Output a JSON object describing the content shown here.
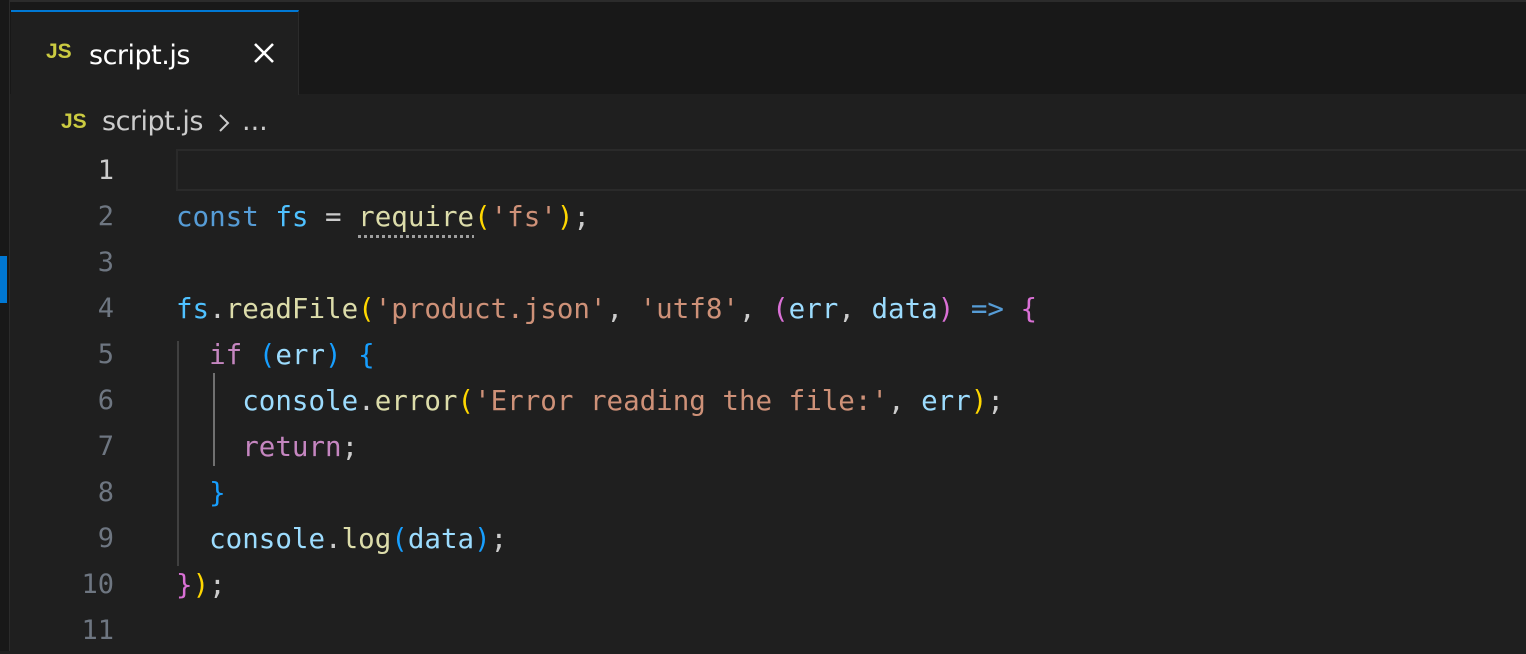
{
  "tab": {
    "icon_label": "JS",
    "title": "script.js",
    "close_icon": "close-icon"
  },
  "breadcrumb": {
    "icon_label": "JS",
    "file": "script.js",
    "separator_icon": "chevron-right-icon",
    "more": "..."
  },
  "editor": {
    "language": "javascript",
    "current_line": 1,
    "line_numbers": [
      "1",
      "2",
      "3",
      "4",
      "5",
      "6",
      "7",
      "8",
      "9",
      "10",
      "11"
    ],
    "lines": [
      "",
      "const fs = require('fs');",
      "",
      "fs.readFile('product.json', 'utf8', (err, data) => {",
      "  if (err) {",
      "    console.error('Error reading the file:', err);",
      "    return;",
      "  }",
      "  console.log(data);",
      "});",
      ""
    ],
    "tokens": {
      "kw_const": "const",
      "var_fs": "fs",
      "op_eq": " = ",
      "fn_require": "require",
      "str_fs": "'fs'",
      "fn_readFile": "readFile",
      "str_product": "'product.json'",
      "str_utf8": "'utf8'",
      "param_err": "err",
      "param_data": "data",
      "arrow": "=>",
      "kw_if": "if",
      "var_console": "console",
      "fn_error": "error",
      "str_error_msg": "'Error reading the file:'",
      "kw_return": "return",
      "fn_log": "log"
    }
  },
  "colors": {
    "background": "#1f1f1f",
    "tab_strip": "#181818",
    "accent": "#0078d4",
    "js_icon": "#cbcb41"
  }
}
